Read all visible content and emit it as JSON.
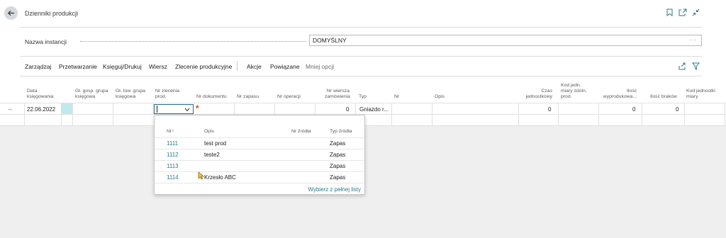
{
  "page": {
    "title": "Dzienniki produkcji"
  },
  "header_icons": [
    "bookmark-icon",
    "open-new-window-icon",
    "collapse-icon"
  ],
  "instance": {
    "label": "Nazwa instancji",
    "value": "DOMYŚLNY",
    "more": "···"
  },
  "actions": {
    "items": [
      "Zarządzaj",
      "Przetwarzanie",
      "Księguj/Drukuj",
      "Wiersz",
      "Zlecenie produkcyjne"
    ],
    "secondary": [
      "Akcje",
      "Powiązane",
      "Mniej opcji"
    ]
  },
  "columns": {
    "data_ksiegowania": [
      "Data",
      "księgowania"
    ],
    "gl_gosp": [
      "Gł. gosp. grupa",
      "księgowa"
    ],
    "gl_tow": [
      "Gł. tow. grupa",
      "księgowa"
    ],
    "nr_zlecenia": [
      "Nr zlecenia",
      "prod."
    ],
    "nr_dokumentu": "Nr dokumentu",
    "nr_zapasu": "Nr zapasu",
    "nr_operacji": "Nr operacji",
    "nr_wiersza": [
      "Nr wiersza",
      "zamówienia"
    ],
    "typ": "Typ",
    "nr": "Nr",
    "opis": "Opis",
    "czas": [
      "Czas",
      "jednostkowy"
    ],
    "kod_jedn_zdoln": [
      "Kod jedn.",
      "miary zdoln.",
      "prod."
    ],
    "ilosc_wyprod": [
      "Ilość",
      "wyprodukowa..."
    ],
    "ilosc_brakow": "Ilość braków",
    "kod_jedn_miary": [
      "Kod jednostki",
      "miary"
    ]
  },
  "row": {
    "data": "22.06.2022",
    "nr_wiersza": "0",
    "typ": "Gniazdo r...",
    "czas": "0",
    "ilosc_wyprod": "0",
    "ilosc_brakow": "0",
    "required_marker": "*",
    "row_arrow": "→"
  },
  "lookup": {
    "headers": {
      "nr": "Nr",
      "sort": "↑",
      "opis": "Opis",
      "nr_zrodla": "Nr źródła",
      "typ_zrodla": "Typ źródła"
    },
    "rows": [
      {
        "nr": "1111",
        "opis": "test prod",
        "typ": "Zapas"
      },
      {
        "nr": "1112",
        "opis": "teste2",
        "typ": "Zapas"
      },
      {
        "nr": "1113",
        "opis": "",
        "typ": "Zapas"
      },
      {
        "nr": "1114",
        "opis": "Krzesło ABC",
        "typ": "Zapas"
      }
    ],
    "footer": "Wybierz z pełnej listy"
  },
  "colors": {
    "accent": "#2a7a8c",
    "required": "#c74b1e",
    "selected_cell": "#c1e7ef"
  }
}
